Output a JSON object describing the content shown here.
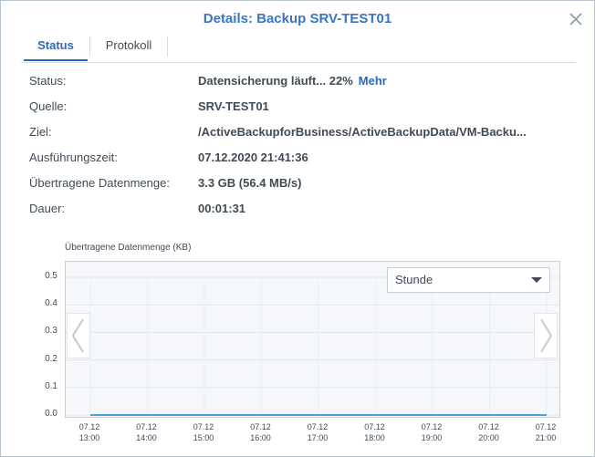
{
  "window": {
    "title": "Details: Backup SRV-TEST01"
  },
  "tabs": [
    {
      "label": "Status",
      "active": true
    },
    {
      "label": "Protokoll",
      "active": false
    }
  ],
  "details": [
    {
      "label": "Status:",
      "value": "Datensicherung läuft... 22%",
      "link": "Mehr"
    },
    {
      "label": "Quelle:",
      "value": "SRV-TEST01"
    },
    {
      "label": "Ziel:",
      "value": "/ActiveBackupforBusiness/ActiveBackupData/VM-Backu..."
    },
    {
      "label": "Ausführungszeit:",
      "value": "07.12.2020 21:41:36"
    },
    {
      "label": "Übertragene Datenmenge:",
      "value": "3.3 GB (56.4 MB/s)"
    },
    {
      "label": "Dauer:",
      "value": "00:01:31"
    }
  ],
  "chart_select": {
    "value": "Stunde"
  },
  "icons": {
    "close": "close-icon",
    "prev": "chevron-left-icon",
    "next": "chevron-right-icon",
    "dropdown": "chevron-down-icon"
  },
  "colors": {
    "accent": "#2b68ba",
    "title": "#3a74c4",
    "line": "#4aa3d8"
  },
  "chart_data": {
    "type": "line",
    "title": "Übertragene Datenmenge (KB)",
    "ylim": [
      0,
      0.5
    ],
    "yticks": [
      "0.5",
      "0.4",
      "0.3",
      "0.2",
      "0.1",
      "0.0"
    ],
    "xticks": [
      [
        "07.12",
        "13:00"
      ],
      [
        "07.12",
        "14:00"
      ],
      [
        "07.12",
        "15:00"
      ],
      [
        "07.12",
        "16:00"
      ],
      [
        "07.12",
        "17:00"
      ],
      [
        "07.12",
        "18:00"
      ],
      [
        "07.12",
        "19:00"
      ],
      [
        "07.12",
        "20:00"
      ],
      [
        "07.12",
        "21:00"
      ]
    ],
    "series": [
      {
        "values": [
          0,
          0,
          0,
          0,
          0,
          0,
          0,
          0,
          0
        ]
      }
    ],
    "grid": true
  }
}
